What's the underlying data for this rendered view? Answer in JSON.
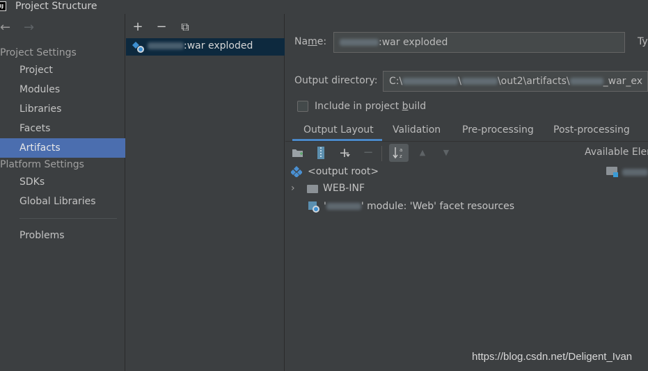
{
  "window": {
    "title": "Project Structure",
    "app_icon_text": "IJ"
  },
  "nav": {
    "back": "←",
    "forward": "→"
  },
  "sidebar": {
    "project_settings_header": "Project Settings",
    "platform_settings_header": "Platform Settings",
    "items": {
      "project": "Project",
      "modules": "Modules",
      "libraries": "Libraries",
      "facets": "Facets",
      "artifacts": "Artifacts",
      "sdks": "SDKs",
      "global_libraries": "Global Libraries",
      "problems": "Problems"
    }
  },
  "artifact_toolbar": {
    "add": "+",
    "remove": "−",
    "copy": "⧉"
  },
  "artifact_list": [
    {
      "suffix": ":war exploded"
    }
  ],
  "form": {
    "name_label_pre": "Na",
    "name_label_mnemonic": "m",
    "name_label_post": "e:",
    "name_value_suffix": ":war exploded",
    "type_label_partial": "Ty",
    "output_dir_label": "Output directory:",
    "output_dir_prefix": "C:\\",
    "output_dir_mid1": "\\",
    "output_dir_mid2": "\\out2\\artifacts\\",
    "output_dir_tail": "_war_ex",
    "include_label_pre": "Include in project ",
    "include_label_mnemonic": "b",
    "include_label_post": "uild",
    "include_checked": false
  },
  "tabs": [
    "Output Layout",
    "Validation",
    "Pre-processing",
    "Post-processing"
  ],
  "active_tab": "Output Layout",
  "layout_toolbar": {
    "new_dir": "📁",
    "add_archive": "▦",
    "add": "+",
    "remove": "−",
    "sort": "↓",
    "up": "▲",
    "down": "▼",
    "available_elements": "Available Elem"
  },
  "tree": {
    "output_root": "<output root>",
    "web_inf": "WEB-INF",
    "facet_resources_pre": "'",
    "facet_resources_post": "' module: 'Web' facet resources"
  },
  "watermark": "https://blog.csdn.net/Deligent_Ivan",
  "colors": {
    "selection": "#4b6eaf",
    "list_selection": "#0d293e",
    "tab_accent": "#4a88c7",
    "background": "#3c3f41"
  }
}
